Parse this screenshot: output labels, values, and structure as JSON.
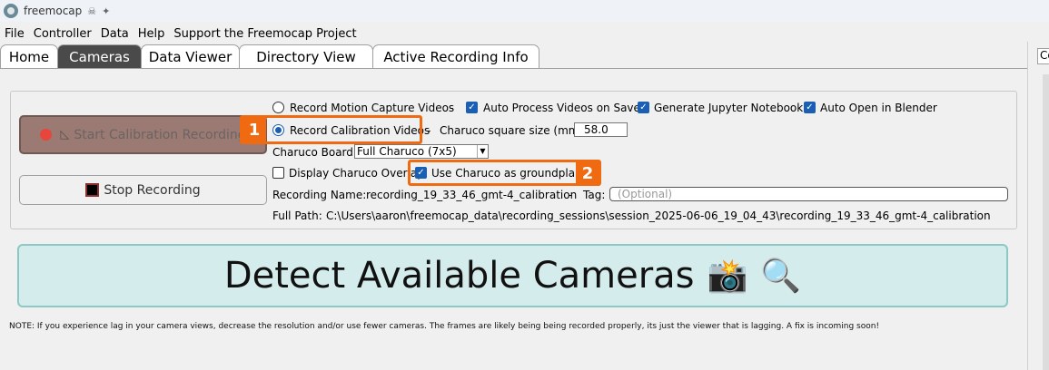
{
  "window": {
    "title": "freemocap"
  },
  "menu": [
    "File",
    "Controller",
    "Data",
    "Help",
    "Support the Freemocap Project"
  ],
  "tabs": [
    {
      "label": "Home",
      "active": false
    },
    {
      "label": "Cameras",
      "active": true
    },
    {
      "label": "Data Viewer",
      "active": false
    },
    {
      "label": "Directory View",
      "active": false
    },
    {
      "label": "Active Recording Info",
      "active": false
    }
  ],
  "side_panel": {
    "label": "Co"
  },
  "buttons": {
    "start_calibration": "Start Calibration Recording",
    "stop_recording": "Stop Recording"
  },
  "options": {
    "record_motion_capture": "Record Motion Capture Videos",
    "auto_process": "Auto Process Videos on Save",
    "jupyter": "Generate Jupyter Notebook",
    "blender": "Auto Open in Blender",
    "record_calibration": "Record Calibration Videos",
    "charuco_size_label": "Charuco square size (mm)",
    "charuco_size_value": "58.0",
    "charuco_board_label": "Charuco Board:",
    "charuco_board_value": "Full Charuco (7x5)",
    "display_overlay": "Display Charuco Overlay",
    "use_groundplane": "Use Charuco as groundplane",
    "recording_name_label": "Recording Name:",
    "recording_name_value": "recording_19_33_46_gmt-4_calibration",
    "tag_label": "Tag:",
    "tag_placeholder": "(Optional)",
    "full_path_label": "Full Path:",
    "full_path_value": "C:\\Users\\aaron\\freemocap_data\\recording_sessions\\session_2025-06-06_19_04_43\\recording_19_33_46_gmt-4_calibration"
  },
  "annotations": {
    "badge1": "1",
    "badge2": "2"
  },
  "detect_button": {
    "label": "Detect Available Cameras"
  },
  "note": "NOTE: If you experience lag in your camera views, decrease the resolution and/or use fewer cameras. The frames are likely being being recorded properly, its just the viewer that is lagging. A fix is incoming soon!",
  "colors": {
    "highlight": "#f06a12",
    "accent": "#1a5fb4",
    "detect_bg": "#d4ecec"
  }
}
